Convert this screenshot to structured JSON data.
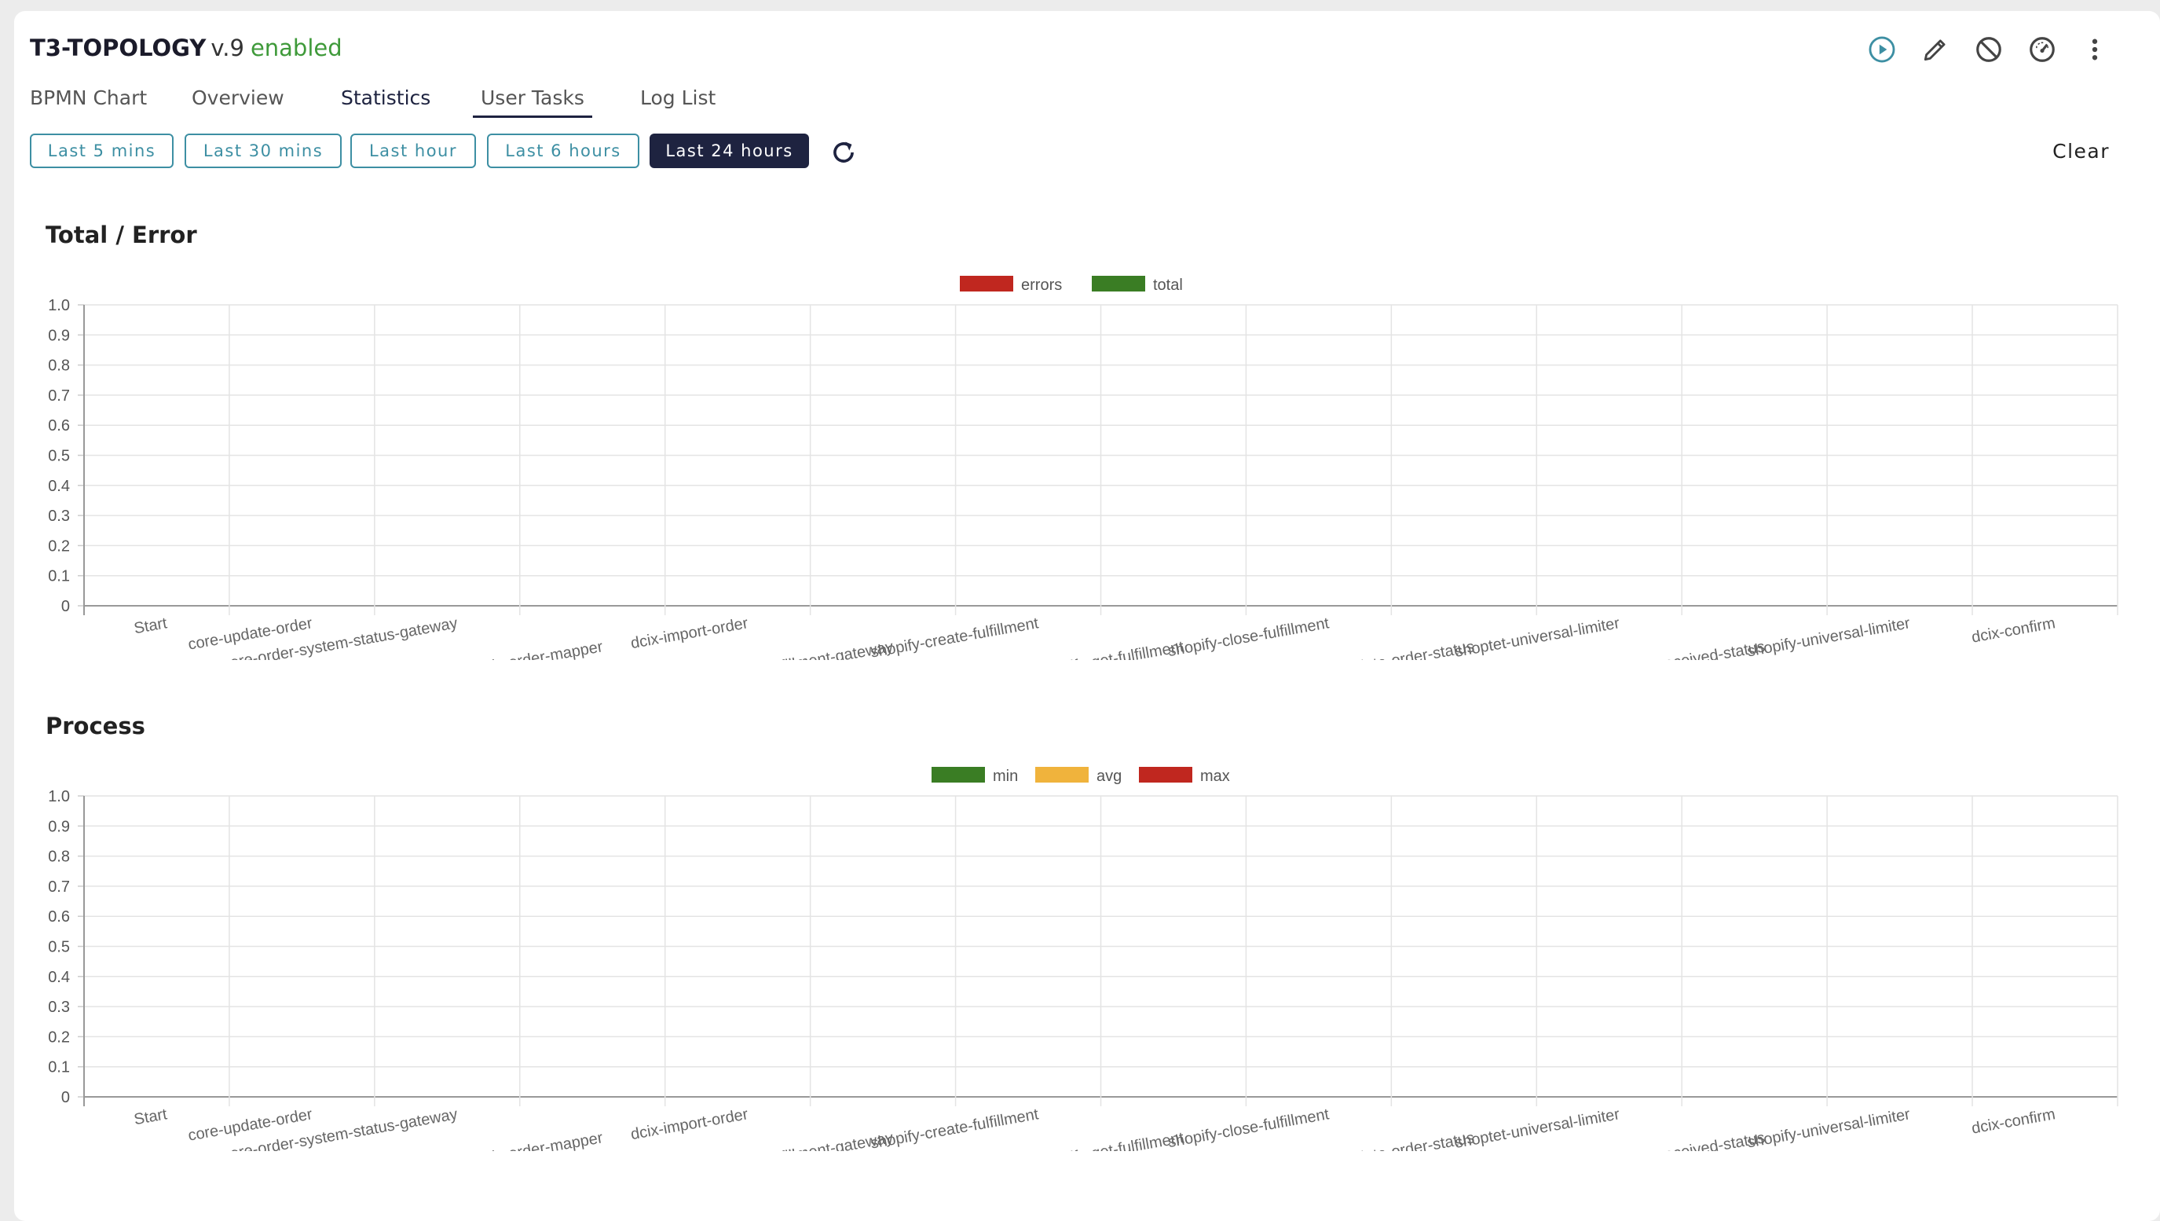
{
  "header": {
    "name": "T3-TOPOLOGY",
    "version": "v.9",
    "status": "enabled"
  },
  "toolbar_icons": [
    "play-circle-icon",
    "pencil-icon",
    "block-icon",
    "dashboard-gauge-icon",
    "more-vertical-icon"
  ],
  "tabs": [
    {
      "label": "BPMN Chart"
    },
    {
      "label": "Overview"
    },
    {
      "label": "Statistics"
    },
    {
      "label": "User Tasks"
    },
    {
      "label": "Log List"
    }
  ],
  "time_ranges": [
    {
      "label": "Last 5 mins"
    },
    {
      "label": "Last 30 mins"
    },
    {
      "label": "Last hour"
    },
    {
      "label": "Last 6 hours"
    },
    {
      "label": "Last 24 hours",
      "selected": true
    }
  ],
  "clear_label": "Clear",
  "sections": {
    "total_error_title": "Total / Error",
    "process_title": "Process"
  },
  "colors": {
    "accent": "#3d8fa3",
    "selected": "#1e2340",
    "enabled": "#3f9a3a",
    "errors": "#c0271f",
    "total": "#3a7d24",
    "min": "#3a7d24",
    "avg": "#f0b33c",
    "max": "#c0271f"
  },
  "chart_data": [
    {
      "type": "bar",
      "categories": [
        "Start",
        "core-update-order",
        "core-order-system-status-gateway",
        "core-to-dcix-order-mapper",
        "dcix-import-order",
        "shopify-fulfillment-gateway",
        "shopify-create-fulfillment",
        "shopify-get-fulfillment",
        "shopify-close-fulfillment",
        "shoptet-update-order-status",
        "shoptet-universal-limiter",
        "core-handle-received-status",
        "shopify-universal-limiter",
        "dcix-confirm"
      ],
      "series": [
        {
          "name": "errors",
          "values": [
            0,
            0,
            0,
            0,
            0,
            0,
            0,
            0,
            0,
            0,
            0,
            0,
            0,
            0
          ]
        },
        {
          "name": "total",
          "values": [
            0,
            0,
            0,
            0,
            0,
            0,
            0,
            0,
            0,
            0,
            0,
            0,
            0,
            0
          ]
        }
      ],
      "yticks": [
        "0",
        "0.1",
        "0.2",
        "0.3",
        "0.4",
        "0.5",
        "0.6",
        "0.7",
        "0.8",
        "0.9",
        "1.0"
      ],
      "ylim": [
        0,
        1
      ],
      "grid": true,
      "legend": "top-center"
    },
    {
      "type": "bar",
      "categories": [
        "Start",
        "core-update-order",
        "core-order-system-status-gateway",
        "core-to-dcix-order-mapper",
        "dcix-import-order",
        "shopify-fulfillment-gateway",
        "shopify-create-fulfillment",
        "shopify-get-fulfillment",
        "shopify-close-fulfillment",
        "shoptet-update-order-status",
        "shoptet-universal-limiter",
        "core-handle-received-status",
        "shopify-universal-limiter",
        "dcix-confirm"
      ],
      "series": [
        {
          "name": "min",
          "values": [
            0,
            0,
            0,
            0,
            0,
            0,
            0,
            0,
            0,
            0,
            0,
            0,
            0,
            0
          ]
        },
        {
          "name": "avg",
          "values": [
            0,
            0,
            0,
            0,
            0,
            0,
            0,
            0,
            0,
            0,
            0,
            0,
            0,
            0
          ]
        },
        {
          "name": "max",
          "values": [
            0,
            0,
            0,
            0,
            0,
            0,
            0,
            0,
            0,
            0,
            0,
            0,
            0,
            0
          ]
        }
      ],
      "yticks": [
        "0",
        "0.1",
        "0.2",
        "0.3",
        "0.4",
        "0.5",
        "0.6",
        "0.7",
        "0.8",
        "0.9",
        "1.0"
      ],
      "ylim": [
        0,
        1
      ],
      "grid": true,
      "legend": "top-center"
    }
  ]
}
